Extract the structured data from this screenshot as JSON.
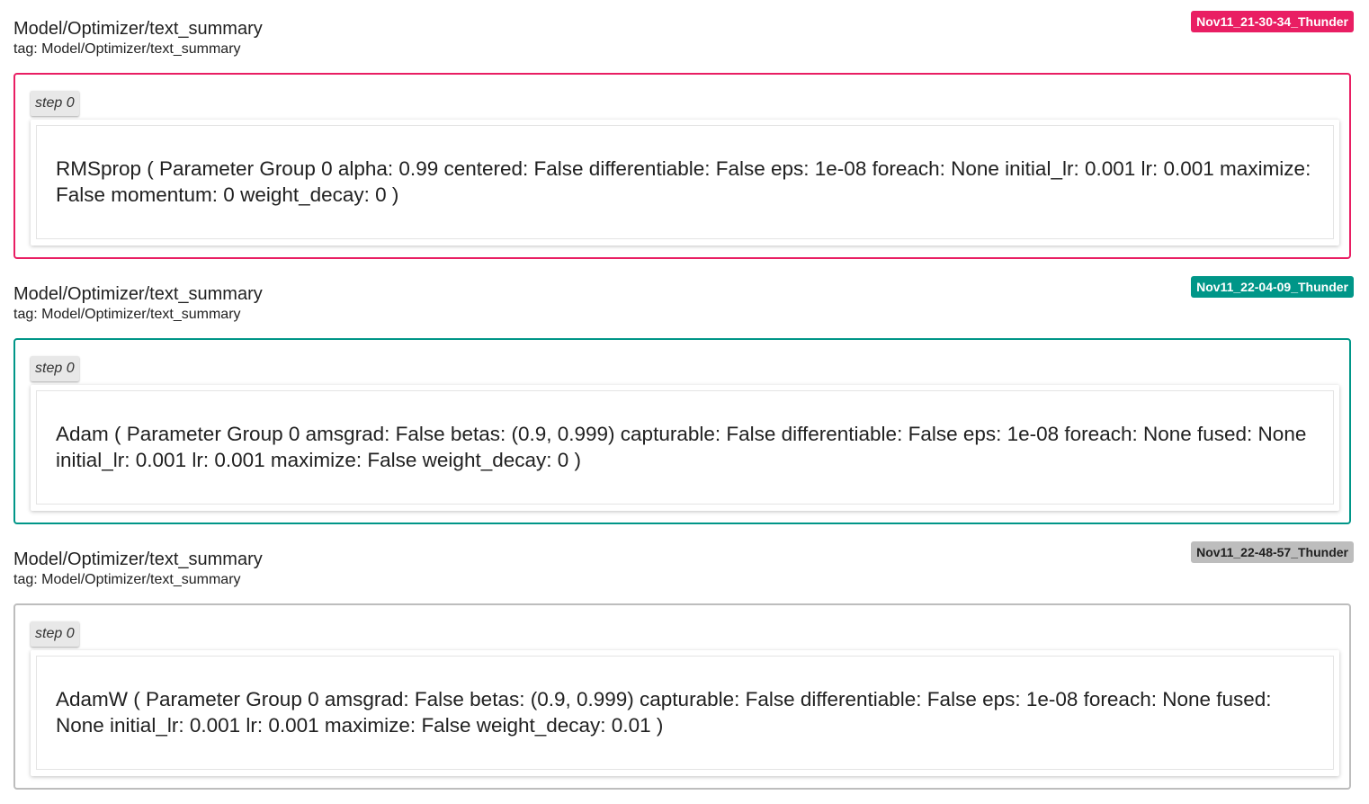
{
  "accents": {
    "run_1": "#e91e63",
    "run_2": "#009688",
    "run_3": "#9e9e9e",
    "run_3_badge_text": "#212121"
  },
  "runs": [
    {
      "title": "Model/Optimizer/text_summary",
      "tag_line": "tag: Model/Optimizer/text_summary",
      "run_name": "Nov11_21-30-34_Thunder",
      "step_label": "step 0",
      "text": "RMSprop ( Parameter Group 0 alpha: 0.99 centered: False differentiable: False eps: 1e-08 foreach: None initial_lr: 0.001 lr: 0.001 maximize: False momentum: 0 weight_decay: 0 )"
    },
    {
      "title": "Model/Optimizer/text_summary",
      "tag_line": "tag: Model/Optimizer/text_summary",
      "run_name": "Nov11_22-04-09_Thunder",
      "step_label": "step 0",
      "text": "Adam ( Parameter Group 0 amsgrad: False betas: (0.9, 0.999) capturable: False differentiable: False eps: 1e-08 foreach: None fused: None initial_lr: 0.001 lr: 0.001 maximize: False weight_decay: 0 )"
    },
    {
      "title": "Model/Optimizer/text_summary",
      "tag_line": "tag: Model/Optimizer/text_summary",
      "run_name": "Nov11_22-48-57_Thunder",
      "step_label": "step 0",
      "text": "AdamW ( Parameter Group 0 amsgrad: False betas: (0.9, 0.999) capturable: False differentiable: False eps: 1e-08 foreach: None fused: None initial_lr: 0.001 lr: 0.001 maximize: False weight_decay: 0.01 )"
    }
  ]
}
